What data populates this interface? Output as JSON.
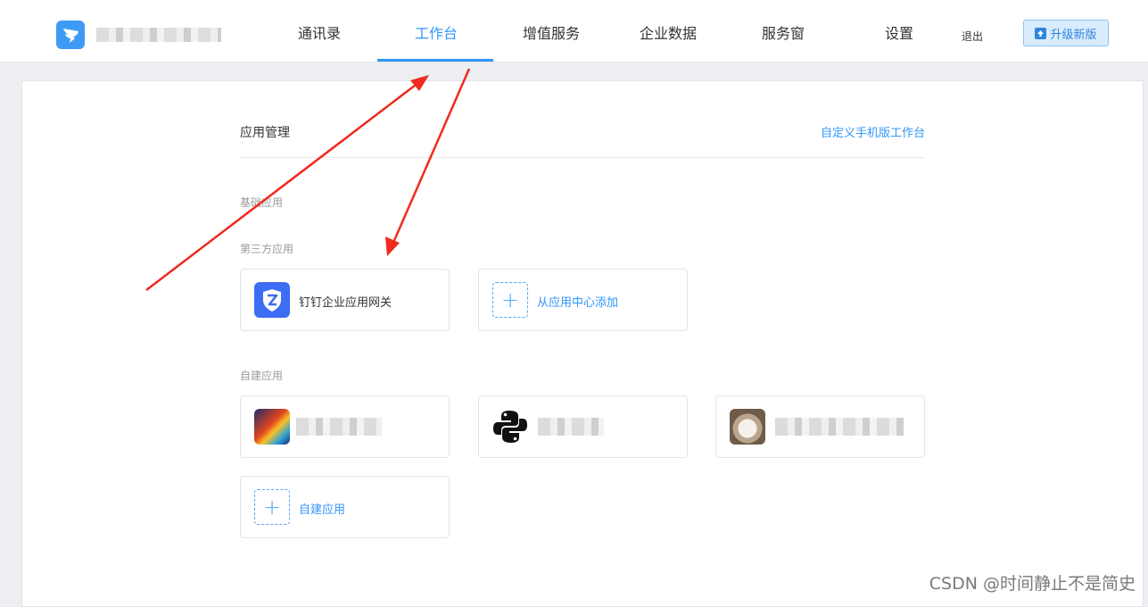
{
  "header": {
    "nav": [
      "通讯录",
      "工作台",
      "增值服务",
      "企业数据",
      "服务窗",
      "设置"
    ],
    "active_nav": "工作台",
    "logout_label": "退出",
    "upgrade_label": "升级新版"
  },
  "main": {
    "section_title": "应用管理",
    "custom_link": "自定义手机版工作台",
    "groups": {
      "basic": "基础应用",
      "third_party": "第三方应用",
      "self_built": "自建应用"
    },
    "third_party_apps": [
      {
        "label": "钉钉企业应用网关",
        "icon": "shield-z-icon"
      },
      {
        "label": "从应用中心添加",
        "icon": "plus-icon"
      }
    ],
    "self_built_add_label": "自建应用"
  },
  "watermark": "CSDN @时间静止不是简史",
  "colors": {
    "accent": "#3296fa",
    "annotation_arrow": "#f02a1f"
  }
}
